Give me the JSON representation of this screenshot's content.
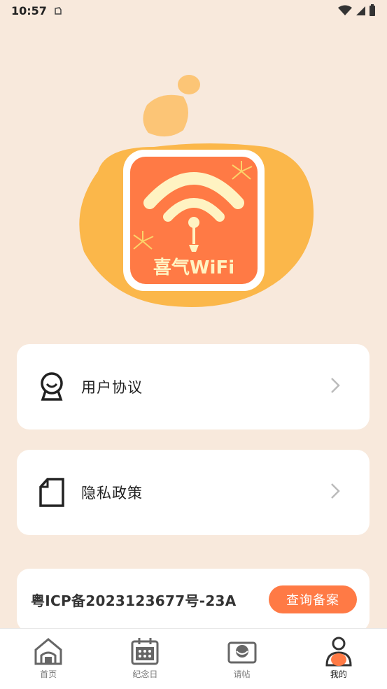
{
  "status_bar": {
    "time": "10:57"
  },
  "logo": {
    "text": "喜气WiFi"
  },
  "menu": [
    {
      "label": "用户协议",
      "icon": "user-agreement-icon"
    },
    {
      "label": "隐私政策",
      "icon": "document-icon"
    }
  ],
  "icp": {
    "text": "粤ICP备2023123677号-23A",
    "button_label": "查询备案"
  },
  "tabs": [
    {
      "label": "首页",
      "icon": "home-icon"
    },
    {
      "label": "纪念日",
      "icon": "calendar-icon"
    },
    {
      "label": "请帖",
      "icon": "invitation-icon"
    },
    {
      "label": "我的",
      "icon": "profile-icon"
    }
  ],
  "colors": {
    "background": "#f8e9dc",
    "accent": "#ff7a45",
    "blob": "#fbb74a"
  }
}
